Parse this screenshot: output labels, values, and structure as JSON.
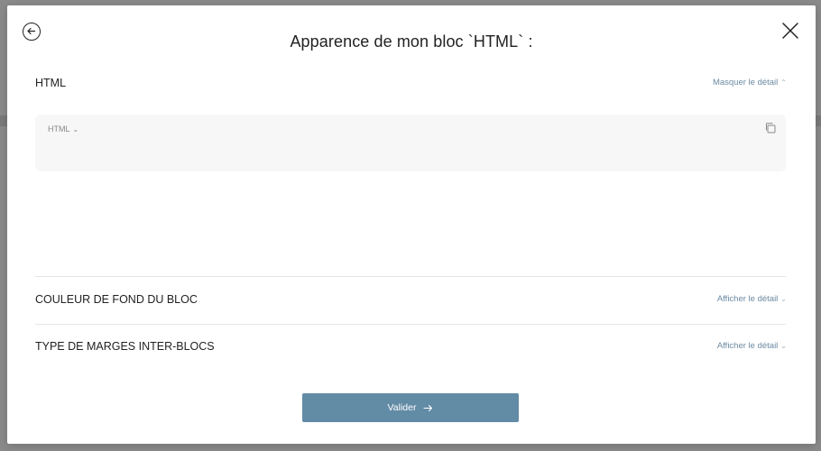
{
  "modal": {
    "title": "Apparence de mon bloc `HTML` :"
  },
  "sections": {
    "html": {
      "title": "HTML",
      "toggle_label": "Masquer le détail",
      "toggle_icon": "chevron-up-icon"
    },
    "background": {
      "title": "COULEUR DE FOND DU BLOC",
      "toggle_label": "Afficher le détail",
      "toggle_icon": "chevron-down-icon"
    },
    "margins": {
      "title": "TYPE DE MARGES INTER-BLOCS",
      "toggle_label": "Afficher le détail",
      "toggle_icon": "chevron-down-icon"
    }
  },
  "editor": {
    "language": "HTML",
    "content": ""
  },
  "actions": {
    "submit_label": "Valider"
  },
  "colors": {
    "accent": "#628ba5",
    "link": "#6b8aa3",
    "editor_bg": "#f7f7f7"
  }
}
